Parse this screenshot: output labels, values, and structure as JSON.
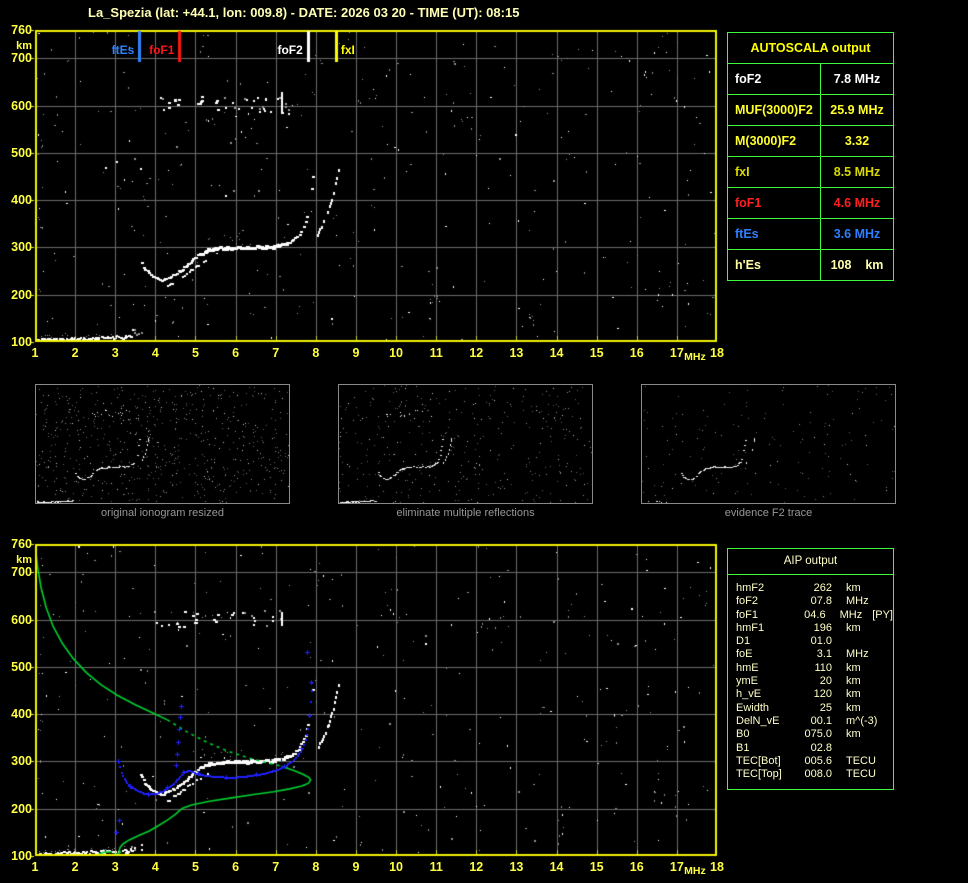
{
  "header": {
    "title": "La_Spezia (lat: +44.1, lon: 009.8) - DATE: 2026 03 20 - TIME (UT): 08:15"
  },
  "autoscala_table": {
    "title": "AUTOSCALA output",
    "border_color": "#3dfa3d",
    "header_color": "#ffff00",
    "rows": [
      {
        "label": "foF2",
        "value": "7.8 MHz",
        "color": "#ffffff"
      },
      {
        "label": "MUF(3000)F2",
        "value": "25.9 MHz",
        "color": "#ffff2e"
      },
      {
        "label": "M(3000)F2",
        "value": "3.32",
        "color": "#ffff2e"
      },
      {
        "label": "fxI",
        "value": "8.5 MHz",
        "color": "#d9d900"
      },
      {
        "label": "foF1",
        "value": "4.6 MHz",
        "color": "#ff1f1f"
      },
      {
        "label": "ftEs",
        "value": "3.6 MHz",
        "color": "#2e7fff"
      },
      {
        "label": "h'Es",
        "value": "108    km",
        "color": "#ffffa8"
      }
    ]
  },
  "aip_table": {
    "title": "AIP output",
    "border_color": "#3dfa3d",
    "text_color": "#ffffc8",
    "rows": [
      {
        "name": "hmF2",
        "value": "262",
        "unit": "km",
        "note": ""
      },
      {
        "name": "foF2",
        "value": "07.8",
        "unit": "MHz",
        "note": ""
      },
      {
        "name": "foF1",
        "value": "04.6",
        "unit": "MHz",
        "note": "[PY]"
      },
      {
        "name": "hmF1",
        "value": "196",
        "unit": "km",
        "note": ""
      },
      {
        "name": "D1",
        "value": "01.0",
        "unit": "",
        "note": ""
      },
      {
        "name": "foE",
        "value": "3.1",
        "unit": "MHz",
        "note": ""
      },
      {
        "name": "hmE",
        "value": "110",
        "unit": "km",
        "note": ""
      },
      {
        "name": "ymE",
        "value": "20",
        "unit": "km",
        "note": ""
      },
      {
        "name": "h_vE",
        "value": "120",
        "unit": "km",
        "note": ""
      },
      {
        "name": "Ewidth",
        "value": "25",
        "unit": "km",
        "note": ""
      },
      {
        "name": "DelN_vE",
        "value": "00.1",
        "unit": "m^(-3)",
        "note": ""
      },
      {
        "name": "B0",
        "value": "075.0",
        "unit": "km",
        "note": ""
      },
      {
        "name": "B1",
        "value": "02.8",
        "unit": "",
        "note": ""
      },
      {
        "name": "TEC[Bot]",
        "value": "005.6",
        "unit": "TECU",
        "note": ""
      },
      {
        "name": "TEC[Top]",
        "value": "008.0",
        "unit": "TECU",
        "note": ""
      }
    ]
  },
  "thumbnails": [
    {
      "caption": "original ionogram resized",
      "noise": 640,
      "second_order": true,
      "e_trace": true
    },
    {
      "caption": "eliminate multiple reflections",
      "noise": 370,
      "second_order": true,
      "e_trace": true
    },
    {
      "caption": "evidence F2 trace",
      "noise": 150,
      "second_order": false,
      "e_trace": false
    }
  ],
  "chart_data": [
    {
      "type": "scatter",
      "name": "scaled ionogram",
      "x_label": "MHz",
      "y_label": "km",
      "xlim": [
        1,
        18
      ],
      "ylim": [
        100,
        760
      ],
      "x_ticks": [
        1,
        2,
        3,
        4,
        5,
        6,
        7,
        8,
        9,
        10,
        11,
        12,
        13,
        14,
        15,
        16,
        17,
        18
      ],
      "y_ticks": [
        760,
        700,
        600,
        500,
        400,
        300,
        200,
        100
      ],
      "grid": true,
      "border_color": "#f2f200",
      "grid_color": "#6a6a6a",
      "markers": [
        {
          "label": "ftEs",
          "freq": 3.6,
          "color": "#2e82ff",
          "side": "left"
        },
        {
          "label": "foF1",
          "freq": 4.6,
          "color": "#ff1515",
          "side": "left"
        },
        {
          "label": "foF2",
          "freq": 7.8,
          "color": "#ffffff",
          "side": "left"
        },
        {
          "label": "fxI",
          "freq": 8.5,
          "color": "#ffff00",
          "side": "right"
        }
      ],
      "autoscala_values": {
        "foF2_MHz": 7.8,
        "MUF3000F2_MHz": 25.9,
        "M3000F2": 3.32,
        "fxI_MHz": 8.5,
        "foF1_MHz": 4.6,
        "ftEs_MHz": 3.6,
        "hEs_km": 108
      },
      "series": {
        "e_trace": {
          "f_range": [
            1.05,
            3.4
          ],
          "h_base": 102,
          "h_slope": 3.2,
          "h_spread": 6
        },
        "f_trace_o": [
          [
            3.62,
            272
          ],
          [
            3.72,
            256
          ],
          [
            3.84,
            244
          ],
          [
            3.98,
            236
          ],
          [
            4.12,
            233
          ],
          [
            4.28,
            236
          ],
          [
            4.44,
            243
          ],
          [
            4.6,
            252
          ],
          [
            4.76,
            263
          ],
          [
            4.92,
            276
          ],
          [
            5.08,
            288
          ],
          [
            5.24,
            295
          ],
          [
            5.45,
            299
          ],
          [
            5.7,
            301
          ],
          [
            6.0,
            302
          ],
          [
            6.3,
            302
          ],
          [
            6.6,
            303
          ],
          [
            6.9,
            304
          ],
          [
            7.1,
            307
          ],
          [
            7.3,
            312
          ],
          [
            7.45,
            320
          ],
          [
            7.58,
            331
          ],
          [
            7.68,
            347
          ],
          [
            7.76,
            368
          ],
          [
            7.82,
            394
          ],
          [
            7.87,
            424
          ],
          [
            7.91,
            452
          ]
        ],
        "f_trace_x": [
          [
            4.3,
            219
          ],
          [
            4.45,
            228
          ],
          [
            4.62,
            238
          ],
          [
            4.8,
            249
          ],
          [
            4.98,
            259
          ],
          [
            5.16,
            268
          ],
          [
            5.32,
            277
          ]
        ],
        "f_trace_x_tail": [
          [
            8.02,
            330
          ],
          [
            8.12,
            345
          ],
          [
            8.22,
            362
          ],
          [
            8.31,
            382
          ],
          [
            8.39,
            404
          ],
          [
            8.46,
            428
          ],
          [
            8.51,
            450
          ],
          [
            8.55,
            466
          ]
        ],
        "second_order": {
          "f_range": [
            3.95,
            7.35
          ],
          "h_range": [
            584,
            622
          ],
          "count": 42,
          "dense_f": [
            4.3,
            5.7
          ],
          "streak_f": 7.14,
          "streak_h": [
            588,
            628
          ]
        }
      },
      "noise": {
        "count": 310,
        "seed": 11,
        "clusters": [
          [
            10.95,
            180,
            8,
            0.15,
            40
          ],
          [
            13.4,
            150,
            6,
            0.1,
            25
          ],
          [
            16.6,
            620,
            10,
            0.6,
            60
          ],
          [
            16.9,
            200,
            8,
            0.4,
            80
          ],
          [
            5.6,
            560,
            8,
            0.8,
            30
          ],
          [
            9.3,
            610,
            6,
            0.3,
            30
          ],
          [
            1.1,
            420,
            6,
            0.08,
            120
          ],
          [
            11.6,
            590,
            7,
            0.25,
            40
          ]
        ]
      }
    },
    {
      "type": "scatter",
      "name": "adjusted ionogram with profile",
      "x_label": "MHz",
      "y_label": "km",
      "xlim": [
        1,
        18
      ],
      "ylim": [
        100,
        760
      ],
      "x_ticks": [
        1,
        2,
        3,
        4,
        5,
        6,
        7,
        8,
        9,
        10,
        11,
        12,
        13,
        14,
        15,
        16,
        17,
        18
      ],
      "y_ticks": [
        760,
        700,
        600,
        500,
        400,
        300,
        200,
        100
      ],
      "grid": true,
      "border_color": "#f2f200",
      "grid_color": "#6a6a6a",
      "markers": [],
      "series": {
        "e_trace": {
          "f_range": [
            1.05,
            3.4
          ],
          "h_base": 102,
          "h_slope": 3.2,
          "h_spread": 6
        },
        "f_trace_o": [
          [
            3.62,
            272
          ],
          [
            3.72,
            256
          ],
          [
            3.84,
            244
          ],
          [
            3.98,
            236
          ],
          [
            4.12,
            233
          ],
          [
            4.28,
            236
          ],
          [
            4.44,
            243
          ],
          [
            4.6,
            252
          ],
          [
            4.76,
            263
          ],
          [
            4.92,
            276
          ],
          [
            5.08,
            288
          ],
          [
            5.24,
            295
          ],
          [
            5.45,
            299
          ],
          [
            5.7,
            301
          ],
          [
            6.0,
            302
          ],
          [
            6.3,
            302
          ],
          [
            6.6,
            303
          ],
          [
            6.9,
            304
          ],
          [
            7.1,
            307
          ],
          [
            7.3,
            312
          ],
          [
            7.45,
            320
          ],
          [
            7.58,
            331
          ],
          [
            7.68,
            347
          ],
          [
            7.76,
            368
          ],
          [
            7.82,
            394
          ],
          [
            7.87,
            424
          ],
          [
            7.91,
            452
          ]
        ],
        "f_trace_x": [
          [
            4.3,
            219
          ],
          [
            4.45,
            228
          ],
          [
            4.62,
            238
          ],
          [
            4.8,
            249
          ],
          [
            4.98,
            259
          ],
          [
            5.16,
            268
          ],
          [
            5.32,
            277
          ]
        ],
        "f_trace_x_tail": [
          [
            8.02,
            330
          ],
          [
            8.12,
            345
          ],
          [
            8.22,
            362
          ],
          [
            8.31,
            382
          ],
          [
            8.39,
            404
          ],
          [
            8.46,
            428
          ],
          [
            8.51,
            450
          ],
          [
            8.55,
            466
          ]
        ],
        "second_order": {
          "f_range": [
            3.95,
            7.35
          ],
          "h_range": [
            584,
            622
          ],
          "count": 30,
          "dense_f": [
            4.4,
            5.9
          ],
          "streak_f": 7.14,
          "streak_h": [
            592,
            618
          ]
        }
      },
      "profile": {
        "color": "#00cf2e",
        "topside_solid": [
          [
            1.0,
            760
          ],
          [
            1.06,
            714
          ],
          [
            1.15,
            668
          ],
          [
            1.28,
            625
          ],
          [
            1.45,
            586
          ],
          [
            1.68,
            550
          ],
          [
            1.95,
            518
          ],
          [
            2.28,
            488
          ],
          [
            2.65,
            462
          ],
          [
            3.05,
            440
          ],
          [
            3.5,
            420
          ],
          [
            3.95,
            402
          ],
          [
            4.3,
            388
          ]
        ],
        "topside_dashed": [
          [
            4.3,
            388
          ],
          [
            4.8,
            362
          ],
          [
            5.3,
            340
          ],
          [
            5.8,
            322
          ],
          [
            6.3,
            308
          ],
          [
            6.8,
            297
          ],
          [
            7.15,
            290
          ]
        ],
        "peak_and_bottomside": [
          [
            7.15,
            290
          ],
          [
            7.45,
            281
          ],
          [
            7.68,
            273
          ],
          [
            7.83,
            266
          ],
          [
            7.87,
            261
          ],
          [
            7.82,
            254
          ],
          [
            7.65,
            248
          ],
          [
            7.35,
            242
          ],
          [
            6.95,
            236
          ],
          [
            6.45,
            230
          ],
          [
            5.9,
            223
          ],
          [
            5.35,
            216
          ],
          [
            4.9,
            208
          ],
          [
            4.68,
            201
          ],
          [
            4.6,
            196
          ],
          [
            4.5,
            188
          ],
          [
            4.3,
            176
          ],
          [
            4.05,
            163
          ],
          [
            3.85,
            153
          ],
          [
            3.6,
            144
          ],
          [
            3.35,
            134
          ],
          [
            3.2,
            126
          ],
          [
            3.12,
            118
          ],
          [
            3.1,
            112
          ],
          [
            3.13,
            108
          ],
          [
            3.05,
            104
          ],
          [
            2.85,
            102
          ],
          [
            2.68,
            102
          ],
          [
            2.62,
            105
          ],
          [
            2.72,
            108
          ],
          [
            2.92,
            109
          ]
        ]
      },
      "fitted_trace": {
        "color": "#2020ff",
        "e_row": {
          "f_range": [
            1.0,
            2.97
          ],
          "h": 104
        },
        "points": [
          [
            3.06,
            302
          ],
          [
            3.14,
            278
          ],
          [
            3.24,
            260
          ],
          [
            3.36,
            249
          ],
          [
            3.5,
            241
          ],
          [
            3.66,
            235
          ],
          [
            3.82,
            232
          ],
          [
            3.98,
            233
          ],
          [
            4.14,
            238
          ],
          [
            4.3,
            245
          ],
          [
            4.44,
            254
          ],
          [
            4.56,
            266
          ],
          [
            4.68,
            278
          ],
          [
            4.8,
            282
          ],
          [
            4.92,
            279
          ],
          [
            5.06,
            275
          ],
          [
            5.25,
            271
          ],
          [
            5.5,
            269
          ],
          [
            5.75,
            268
          ],
          [
            6.0,
            268
          ],
          [
            6.25,
            270
          ],
          [
            6.5,
            273
          ],
          [
            6.75,
            277
          ],
          [
            7.0,
            283
          ],
          [
            7.2,
            291
          ],
          [
            7.38,
            301
          ],
          [
            7.52,
            313
          ],
          [
            7.63,
            328
          ],
          [
            7.72,
            347
          ],
          [
            7.78,
            370
          ],
          [
            7.82,
            398
          ],
          [
            7.85,
            428
          ],
          [
            7.87,
            452
          ],
          [
            7.88,
            468
          ]
        ],
        "cusp_spike": [
          [
            4.52,
            292
          ],
          [
            4.55,
            316
          ],
          [
            4.57,
            342
          ],
          [
            4.59,
            368
          ],
          [
            4.61,
            394
          ],
          [
            4.63,
            418
          ]
        ],
        "strays": [
          [
            7.79,
            532
          ],
          [
            3.03,
            150
          ],
          [
            3.09,
            176
          ]
        ]
      },
      "noise": {
        "count": 300,
        "seed": 23,
        "clusters": [
          [
            5.2,
            600,
            10,
            0.7,
            30
          ],
          [
            12.6,
            620,
            9,
            0.5,
            40
          ],
          [
            16.8,
            300,
            8,
            0.4,
            90
          ],
          [
            9.9,
            640,
            6,
            0.4,
            40
          ],
          [
            1.12,
            500,
            6,
            0.08,
            150
          ],
          [
            14.2,
            170,
            6,
            0.3,
            40
          ],
          [
            7.9,
            700,
            5,
            0.3,
            30
          ]
        ]
      }
    }
  ]
}
